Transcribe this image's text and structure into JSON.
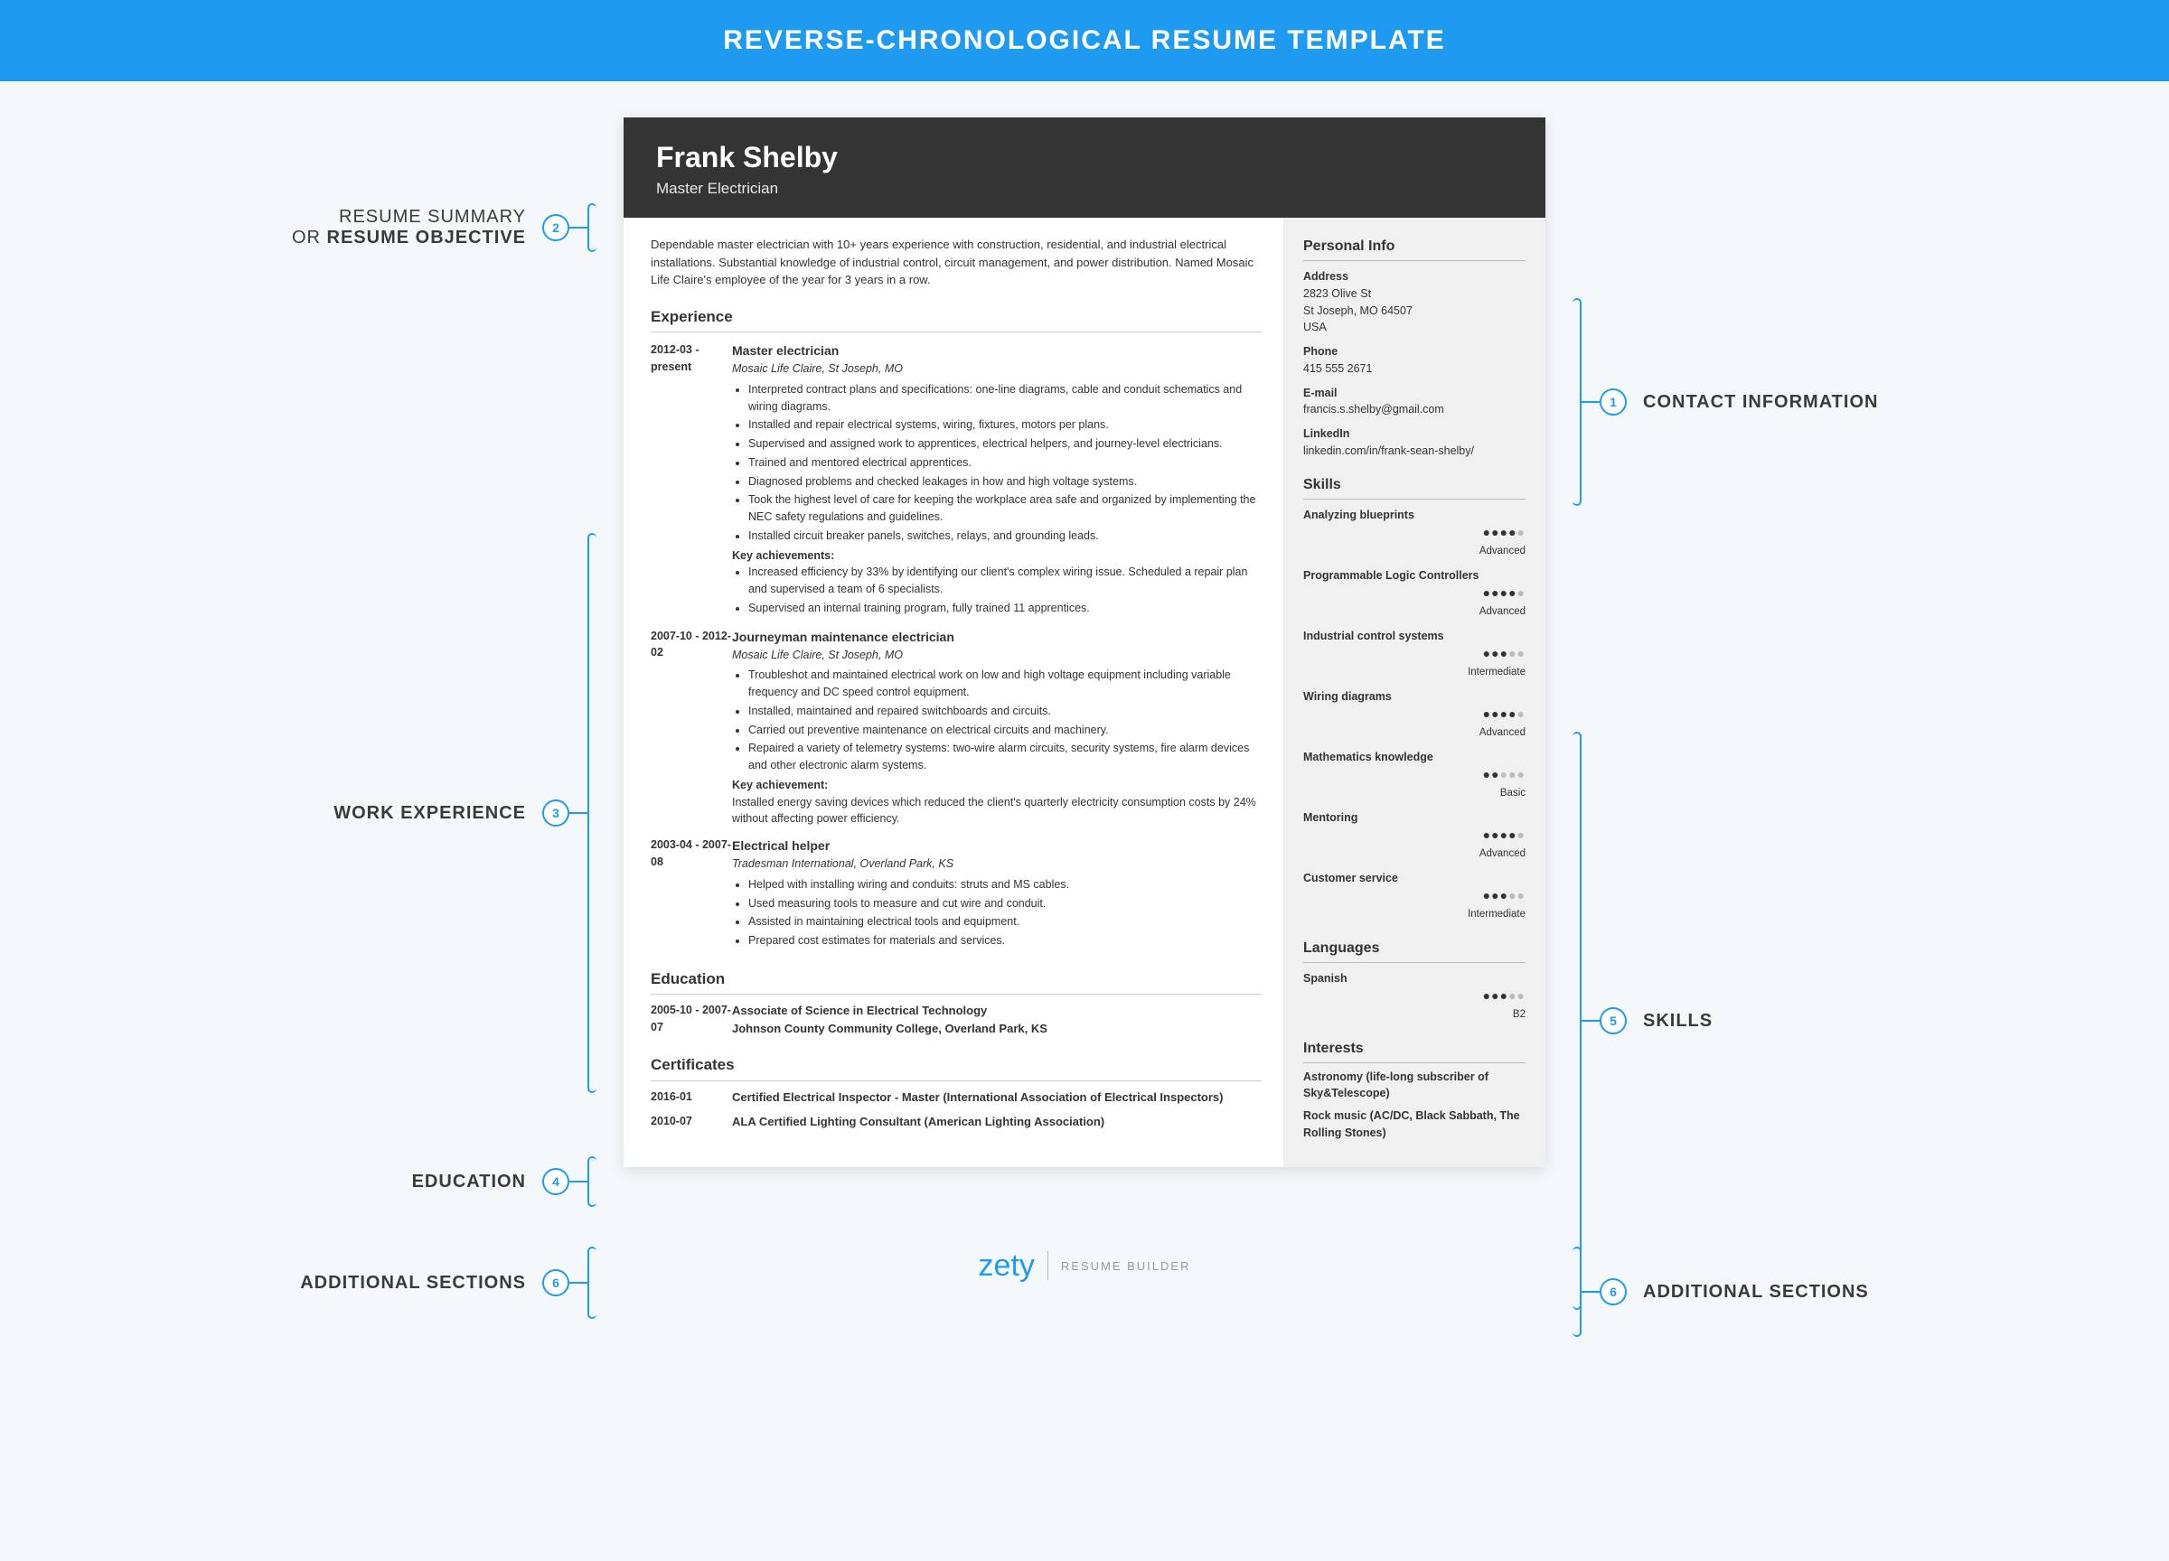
{
  "header": {
    "title": "REVERSE-CHRONOLOGICAL RESUME TEMPLATE"
  },
  "callouts": {
    "summary": {
      "num": "2",
      "label_thin": "RESUME SUMMARY",
      "label_or": "OR ",
      "label_bold": "RESUME OBJECTIVE"
    },
    "experience": {
      "num": "3",
      "label": "WORK EXPERIENCE"
    },
    "education": {
      "num": "4",
      "label": "EDUCATION"
    },
    "additional_left": {
      "num": "6",
      "label": "ADDITIONAL SECTIONS"
    },
    "contact": {
      "num": "1",
      "label": "CONTACT INFORMATION"
    },
    "skills": {
      "num": "5",
      "label": "SKILLS"
    },
    "additional_right": {
      "num": "6",
      "label": "ADDITIONAL SECTIONS"
    }
  },
  "resume": {
    "name": "Frank Shelby",
    "title": "Master Electrician",
    "summary": "Dependable master electrician with 10+ years experience with construction, residential, and industrial electrical installations. Substantial knowledge of industrial control, circuit management, and power distribution. Named Mosaic Life Claire's employee of the year for 3 years in a row.",
    "experience_title": "Experience",
    "experience": [
      {
        "dates": "2012-03 - present",
        "role": "Master electrician",
        "org": "Mosaic Life Claire, St Joseph, MO",
        "bullets": [
          "Interpreted contract plans and specifications: one-line diagrams, cable and conduit schematics and wiring diagrams.",
          "Installed and repair electrical systems, wiring, fixtures, motors per plans.",
          "Supervised and assigned work to apprentices, electrical helpers, and journey-level electricians.",
          "Trained and mentored electrical apprentices.",
          "Diagnosed problems and checked leakages in how and high voltage systems.",
          "Took the highest level of care for keeping the workplace area safe and organized by implementing the NEC safety regulations and guidelines.",
          "Installed circuit breaker panels, switches, relays, and grounding leads."
        ],
        "ach_label": "Key achievements:",
        "achievements": [
          "Increased efficiency by 33% by identifying our client's complex wiring issue. Scheduled a repair plan and supervised a team of 6 specialists.",
          "Supervised an internal training program, fully trained 11 apprentices."
        ]
      },
      {
        "dates": "2007-10 - 2012-02",
        "role": "Journeyman maintenance electrician",
        "org": "Mosaic Life Claire, St Joseph, MO",
        "bullets": [
          "Troubleshot and maintained electrical work on low and high voltage equipment including variable frequency and DC speed control equipment.",
          "Installed, maintained and repaired switchboards and circuits.",
          "Carried out preventive maintenance on electrical circuits and machinery.",
          "Repaired a variety of telemetry systems: two-wire alarm circuits, security systems, fire alarm devices and other electronic alarm systems."
        ],
        "ach_label": "Key achievement:",
        "ach_text": "Installed energy saving devices which reduced the client's quarterly electricity consumption costs by 24% without affecting power efficiency."
      },
      {
        "dates": "2003-04 - 2007-08",
        "role": "Electrical helper",
        "org": "Tradesman International, Overland Park, KS",
        "bullets": [
          "Helped with installing wiring and conduits: struts and MS cables.",
          "Used measuring tools to measure and cut wire and conduit.",
          "Assisted in maintaining electrical tools and equipment.",
          "Prepared cost estimates for materials and services."
        ]
      }
    ],
    "education_title": "Education",
    "education": {
      "dates": "2005-10 - 2007-07",
      "degree": "Associate of Science in Electrical Technology",
      "school": "Johnson County Community College, Overland Park, KS"
    },
    "certificates_title": "Certificates",
    "certificates": [
      {
        "date": "2016-01",
        "name": "Certified Electrical Inspector - Master (International Association of Electrical Inspectors)"
      },
      {
        "date": "2010-07",
        "name": "ALA Certified Lighting Consultant (American Lighting Association)"
      }
    ],
    "sidebar": {
      "personal_title": "Personal Info",
      "address_label": "Address",
      "address_l1": "2823 Olive St",
      "address_l2": "St Joseph, MO 64507",
      "address_l3": "USA",
      "phone_label": "Phone",
      "phone": "415 555 2671",
      "email_label": "E-mail",
      "email": "francis.s.shelby@gmail.com",
      "linkedin_label": "LinkedIn",
      "linkedin": "linkedin.com/in/frank-sean-shelby/",
      "skills_title": "Skills",
      "skills": [
        {
          "name": "Analyzing blueprints",
          "filled": 4,
          "level": "Advanced"
        },
        {
          "name": "Programmable Logic Controllers",
          "filled": 4,
          "level": "Advanced"
        },
        {
          "name": "Industrial control systems",
          "filled": 3,
          "level": "Intermediate"
        },
        {
          "name": "Wiring diagrams",
          "filled": 4,
          "level": "Advanced"
        },
        {
          "name": "Mathematics knowledge",
          "filled": 2,
          "level": "Basic"
        },
        {
          "name": "Mentoring",
          "filled": 4,
          "level": "Advanced"
        },
        {
          "name": "Customer service",
          "filled": 3,
          "level": "Intermediate"
        }
      ],
      "languages_title": "Languages",
      "languages": [
        {
          "name": "Spanish",
          "filled": 3,
          "level": "B2"
        }
      ],
      "interests_title": "Interests",
      "interests": [
        "Astronomy (life-long subscriber of Sky&Telescope)",
        "Rock music (AC/DC, Black Sabbath, The Rolling Stones)"
      ]
    }
  },
  "footer": {
    "brand": "zety",
    "builder": "RESUME BUILDER"
  }
}
